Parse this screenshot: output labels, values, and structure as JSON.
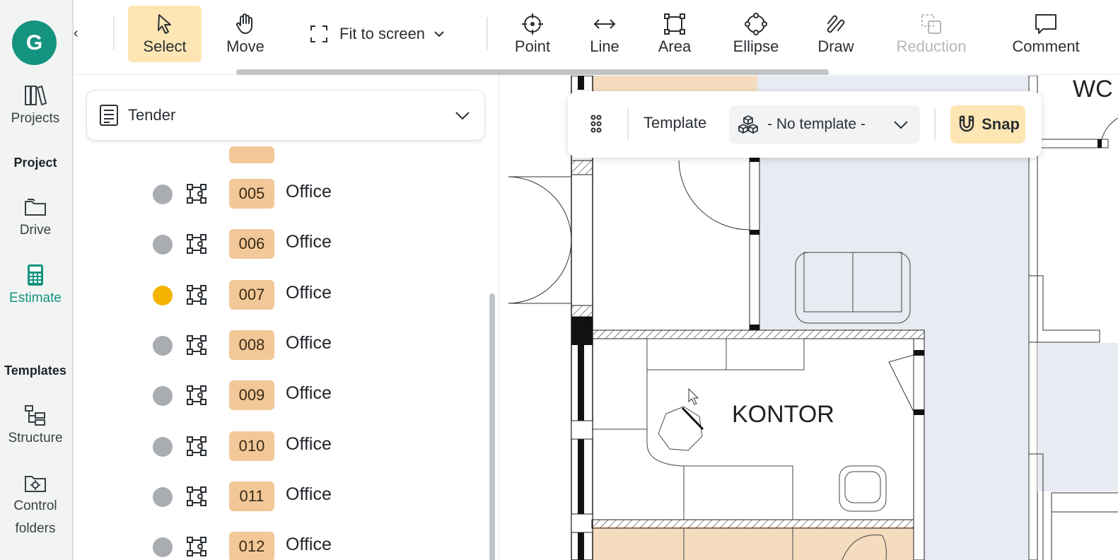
{
  "rail": {
    "avatar_letter": "G",
    "projects": "Projects",
    "section_project": "Project",
    "drive": "Drive",
    "estimate": "Estimate",
    "section_templates": "Templates",
    "structure": "Structure",
    "control_folders_line1": "Control",
    "control_folders_line2": "folders"
  },
  "toolbar": {
    "select": "Select",
    "move": "Move",
    "fit_to_screen": "Fit to screen",
    "point": "Point",
    "line": "Line",
    "area": "Area",
    "ellipse": "Ellipse",
    "draw": "Draw",
    "reduction": "Reduction",
    "comment": "Comment"
  },
  "panel": {
    "dropdown_value": "Tender",
    "rows": [
      {
        "number": "005",
        "name": "Office",
        "status_color": "#a9adb1"
      },
      {
        "number": "006",
        "name": "Office",
        "status_color": "#a9adb1"
      },
      {
        "number": "007",
        "name": "Office",
        "status_color": "#f5b400"
      },
      {
        "number": "008",
        "name": "Office",
        "status_color": "#a9adb1"
      },
      {
        "number": "009",
        "name": "Office",
        "status_color": "#a9adb1"
      },
      {
        "number": "010",
        "name": "Office",
        "status_color": "#a9adb1"
      },
      {
        "number": "011",
        "name": "Office",
        "status_color": "#a9adb1"
      },
      {
        "number": "012",
        "name": "Office",
        "status_color": "#a9adb1"
      }
    ]
  },
  "template_bar": {
    "label": "Template",
    "selected": "- No template -",
    "snap": "Snap"
  },
  "canvas": {
    "room_label": "KONTOR",
    "corner_label": "WC"
  },
  "colors": {
    "accent": "#14937f",
    "active_tool": "#fde6b4",
    "room_badge": "#f2c898"
  }
}
